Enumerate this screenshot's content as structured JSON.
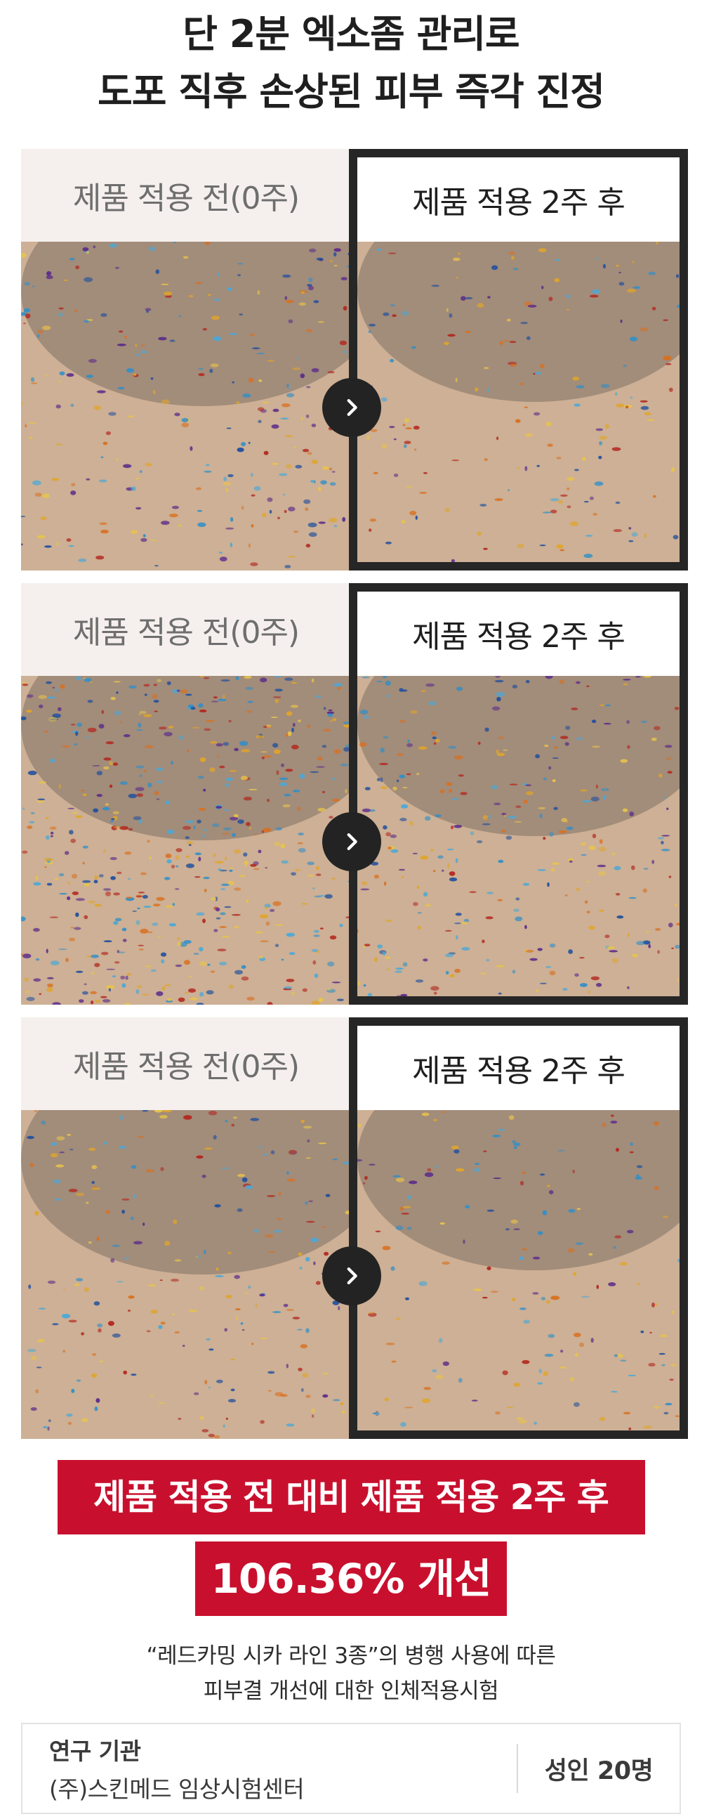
{
  "headline": {
    "line1": "단 2분 엑소좀 관리로",
    "line2": "도포 직후 손상된 피부 즉각 진정"
  },
  "comparisons": [
    {
      "before_label": "제품 적용 전(0주)",
      "after_label": "제품 적용 2주 후"
    },
    {
      "before_label": "제품 적용 전(0주)",
      "after_label": "제품 적용 2주 후"
    },
    {
      "before_label": "제품 적용 전(0주)",
      "after_label": "제품 적용 2주 후"
    }
  ],
  "result": {
    "line1": "제품 적용 전 대비 제품 적용 2주 후",
    "line2": "106.36% 개선"
  },
  "note": {
    "line1": "“레드카밍 시카 라인 3종”의 병행 사용에 따른",
    "line2": "피부결 개선에 대한 인체적용시험"
  },
  "info": {
    "org_label": "연구 기관",
    "org_value": "(주)스킨메드 임상시험센터",
    "subjects": "성인 20명"
  },
  "colors": {
    "accent": "#c8102e",
    "frame": "#262626",
    "before_bg": "#f5f0ed"
  }
}
